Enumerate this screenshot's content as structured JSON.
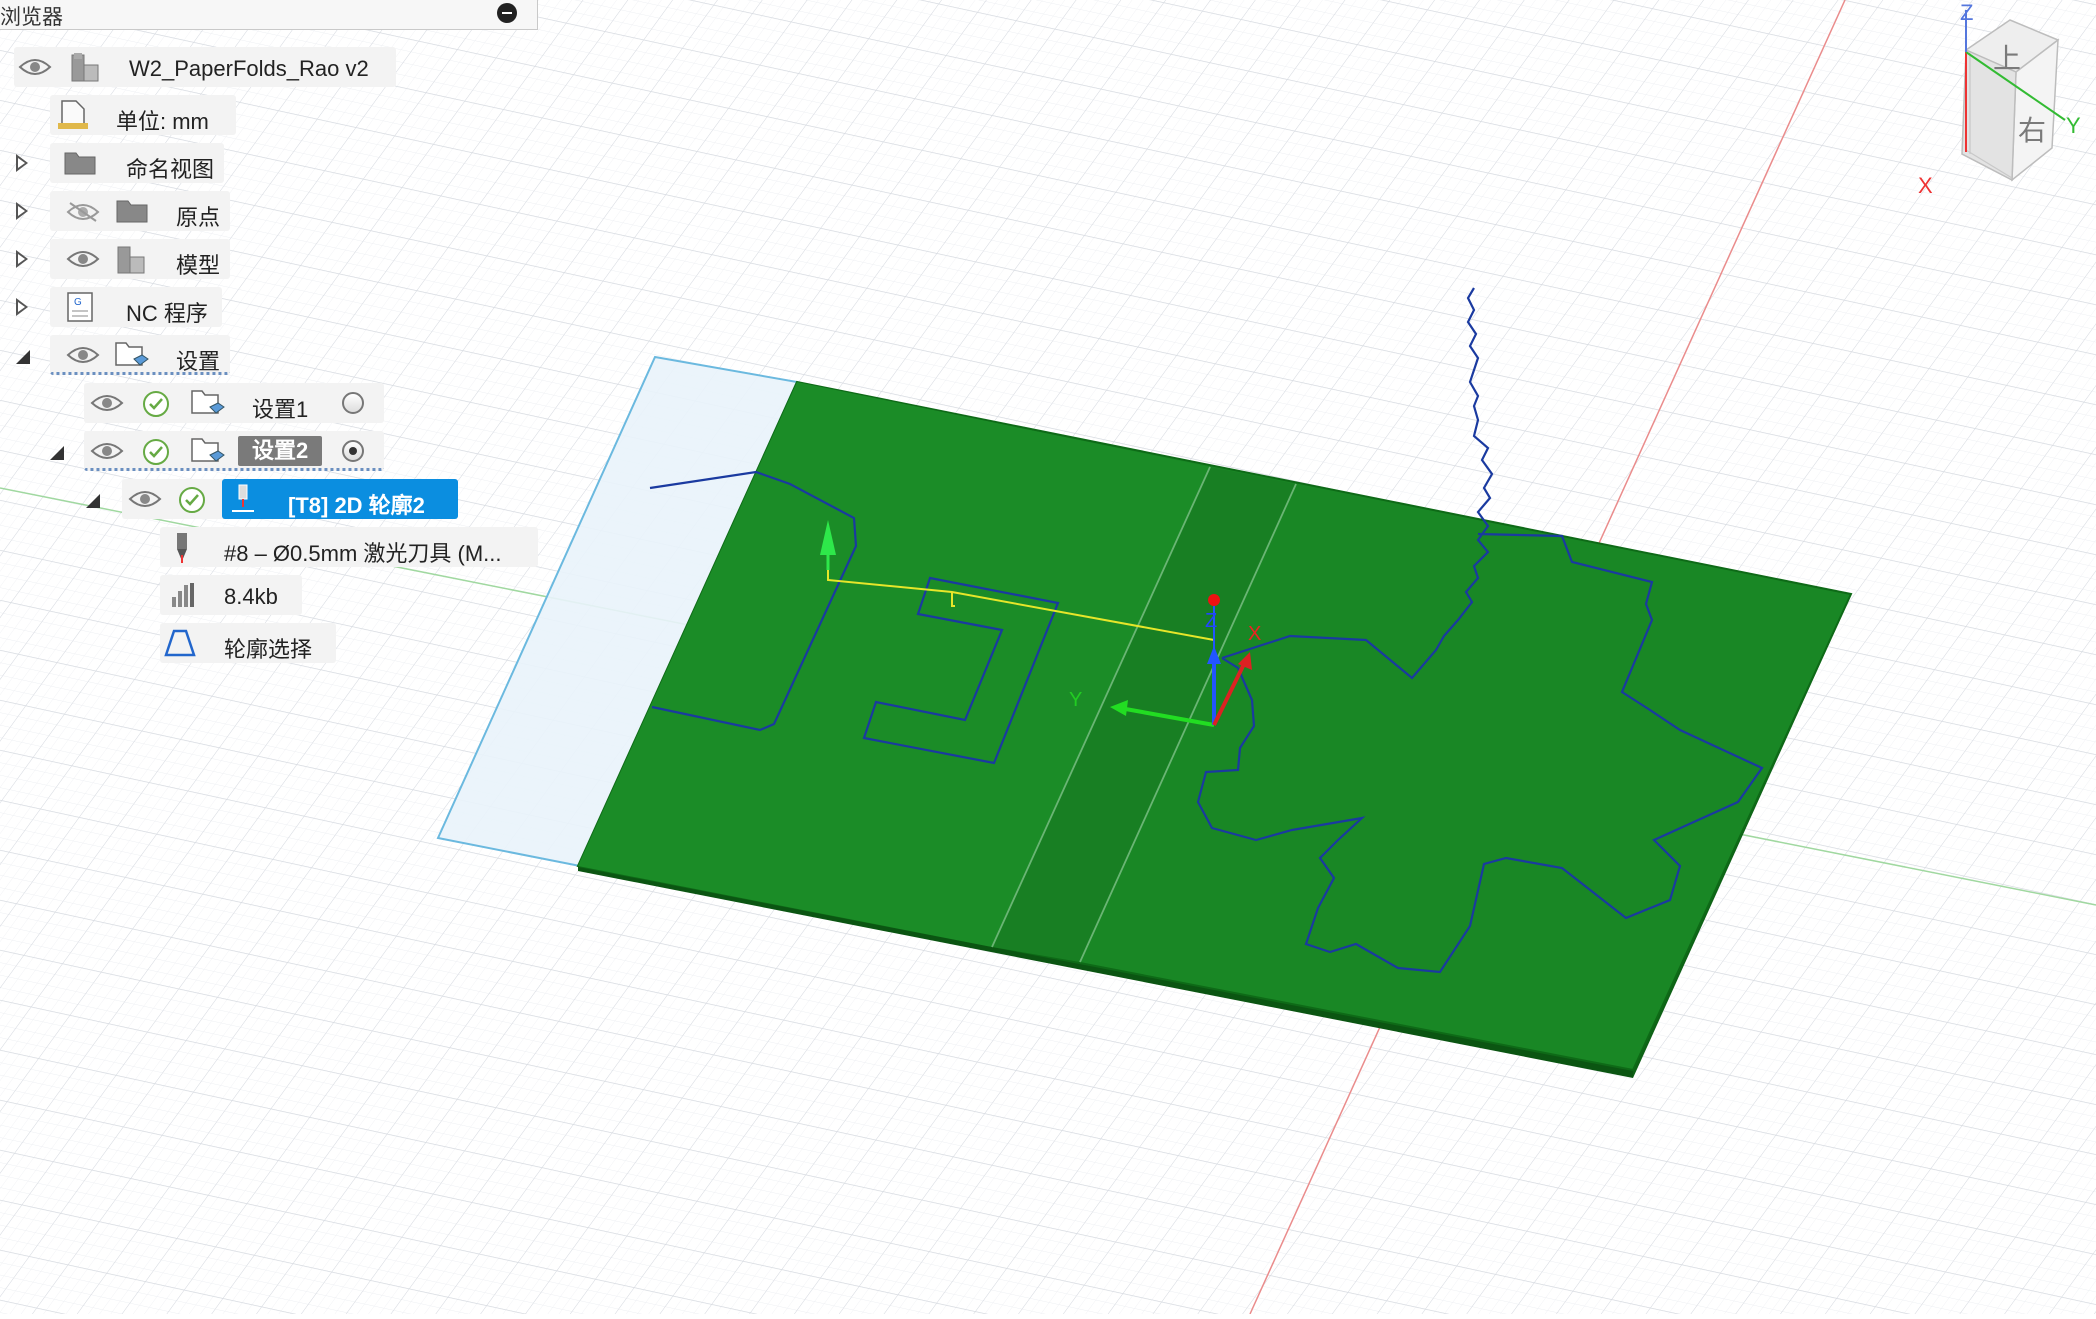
{
  "panel": {
    "title": "浏览器"
  },
  "tree": {
    "root": "W2_PaperFolds_Rao v2",
    "units": "单位: mm",
    "named_views": "命名视图",
    "origin": "原点",
    "model": "模型",
    "nc_programs": "NC 程序",
    "setups": "设置",
    "setup1": "设置1",
    "setup2": "设置2",
    "operation": "[T8] 2D 轮廓2",
    "tool": "#8 – Ø0.5mm 激光刀具 (M...",
    "size": "8.4kb",
    "contour": "轮廓选择"
  },
  "viewport": {
    "axis_x": "X",
    "axis_y": "Y",
    "axis_z": "Z",
    "stock_color": "#1a8a24",
    "contour_color": "#1a3aa0",
    "toolpath_color": "#e6e62a"
  },
  "viewcube": {
    "face_top": "上",
    "face_right": "右",
    "axis_x": "X",
    "axis_y": "Y",
    "axis_z": "Z"
  },
  "icons": [
    "eye-icon",
    "eye-hidden-icon",
    "component-icon",
    "document-icon",
    "folder-icon",
    "nc-program-icon",
    "setup-icon",
    "check-icon",
    "tool-icon",
    "laser-tool-icon",
    "file-size-icon",
    "contour-icon"
  ]
}
